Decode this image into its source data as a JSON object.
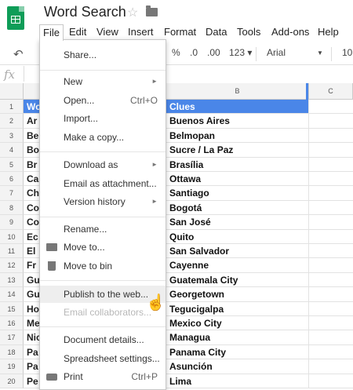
{
  "title": "Word Search",
  "menubar": [
    "File",
    "Edit",
    "View",
    "Insert",
    "Format",
    "Data",
    "Tools",
    "Add-ons",
    "Help"
  ],
  "toolbar": {
    "percent": "%",
    "dec_less": ".0",
    "dec_more": ".00",
    "more_formats": "123 ▾",
    "font": "Arial",
    "font_size": "10"
  },
  "formula_label": "fx",
  "columns": {
    "b": "B",
    "c": "C"
  },
  "rows": [
    {
      "n": "1",
      "a": "Wo",
      "b": "Clues"
    },
    {
      "n": "2",
      "a": "Ar",
      "b": "Buenos Aires"
    },
    {
      "n": "3",
      "a": "Be",
      "b": "Belmopan"
    },
    {
      "n": "4",
      "a": "Bo",
      "b": "Sucre / La Paz"
    },
    {
      "n": "5",
      "a": "Br",
      "b": "Brasília"
    },
    {
      "n": "6",
      "a": "Ca",
      "b": "Ottawa"
    },
    {
      "n": "7",
      "a": "Ch",
      "b": "Santiago"
    },
    {
      "n": "8",
      "a": "Co",
      "b": "Bogotá"
    },
    {
      "n": "9",
      "a": "Co",
      "b": "San José"
    },
    {
      "n": "10",
      "a": "Ec",
      "b": "Quito"
    },
    {
      "n": "11",
      "a": "El",
      "b": "San Salvador"
    },
    {
      "n": "12",
      "a": "Fr",
      "b": "Cayenne"
    },
    {
      "n": "13",
      "a": "Gu",
      "b": "Guatemala City"
    },
    {
      "n": "14",
      "a": "Gu",
      "b": "Georgetown"
    },
    {
      "n": "15",
      "a": "Ho",
      "b": "Tegucigalpa"
    },
    {
      "n": "16",
      "a": "Me",
      "b": "Mexico City"
    },
    {
      "n": "17",
      "a": "Nic",
      "b": "Managua"
    },
    {
      "n": "18",
      "a": "Pa",
      "b": "Panama City"
    },
    {
      "n": "19",
      "a": "Pa",
      "b": "Asunción"
    },
    {
      "n": "20",
      "a": "Pe",
      "b": "Lima"
    }
  ],
  "file_menu": {
    "share": "Share...",
    "new": "New",
    "open": "Open...",
    "open_shortcut": "Ctrl+O",
    "import": "Import...",
    "make_copy": "Make a copy...",
    "download_as": "Download as",
    "email_attachment": "Email as attachment...",
    "version_history": "Version history",
    "rename": "Rename...",
    "move_to": "Move to...",
    "move_to_bin": "Move to bin",
    "publish": "Publish to the web...",
    "email_collaborators": "Email collaborators...",
    "document_details": "Document details...",
    "spreadsheet_settings": "Spreadsheet settings...",
    "print": "Print",
    "print_shortcut": "Ctrl+P"
  }
}
